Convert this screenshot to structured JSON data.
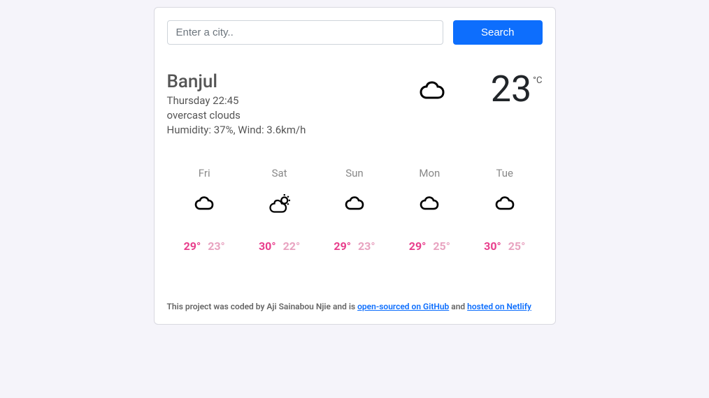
{
  "search": {
    "placeholder": "Enter a city..",
    "button_label": "Search"
  },
  "current": {
    "city": "Banjul",
    "datetime": "Thursday 22:45",
    "description": "overcast clouds",
    "details": "Humidity: 37%, Wind: 3.6km/h",
    "temperature": "23",
    "unit": "°C",
    "icon": "cloud"
  },
  "forecast": [
    {
      "day": "Fri",
      "icon": "cloud",
      "high": "29°",
      "low": "23°"
    },
    {
      "day": "Sat",
      "icon": "partly-cloudy",
      "high": "30°",
      "low": "22°"
    },
    {
      "day": "Sun",
      "icon": "cloud",
      "high": "29°",
      "low": "23°"
    },
    {
      "day": "Mon",
      "icon": "cloud",
      "high": "29°",
      "low": "25°"
    },
    {
      "day": "Tue",
      "icon": "cloud",
      "high": "30°",
      "low": "25°"
    }
  ],
  "footer": {
    "prefix": "This project was coded by Aji Sainabou Njie and is ",
    "link1_text": "open-sourced on GitHub",
    "middle": " and ",
    "link2_text": "hosted on Netlify"
  }
}
